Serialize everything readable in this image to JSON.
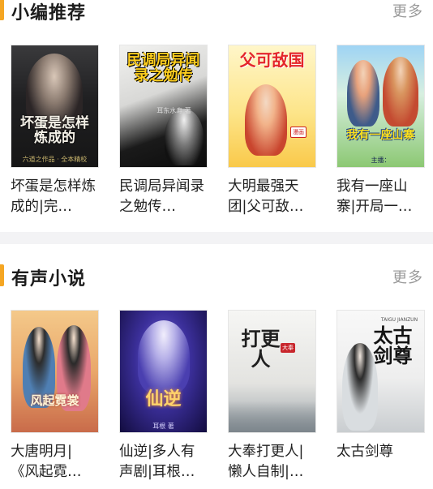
{
  "colors": {
    "accent": "#f5a623",
    "divider": "#f3f3f5",
    "more": "#9a9a9a"
  },
  "sections": [
    {
      "title": "小编推荐",
      "more": "更多",
      "books": [
        {
          "title": "坏蛋是怎样炼成的|完…",
          "cover_text": "坏蛋是怎样炼成的",
          "cover_sub": "六道之作品 · 全本精校"
        },
        {
          "title": "民调局异闻录之勉传…",
          "cover_text": "民调局异闻录之勉传",
          "cover_sub": "耳东水寿 著"
        },
        {
          "title": "大明最强天团|父可敌…",
          "cover_text": "父可敌国",
          "cover_sub": "漫画"
        },
        {
          "title": "我有一座山寨|开局一…",
          "cover_text": "我有一座山寨",
          "cover_sub": "主播："
        }
      ]
    },
    {
      "title": "有声小说",
      "more": "更多",
      "books": [
        {
          "title": "大唐明月|《风起霓…",
          "cover_text": "风起霓裳",
          "cover_sub": ""
        },
        {
          "title": "仙逆|多人有声剧|耳根…",
          "cover_text": "仙逆",
          "cover_sub": "耳根 著"
        },
        {
          "title": "大奉打更人|懒人自制|…",
          "cover_text": "打更人",
          "cover_sub": "大奉"
        },
        {
          "title": "太古剑尊",
          "cover_text": "太古剑尊",
          "cover_sub": "TAIGU JIANZUN"
        }
      ]
    }
  ]
}
